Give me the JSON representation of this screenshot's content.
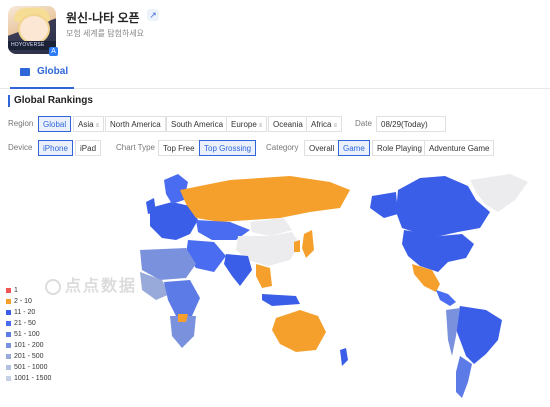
{
  "app": {
    "title": "원신-나타 오픈",
    "subtitle": "모험 세계를 탐험하세요",
    "icon_banner_text": "HOYOVERSE",
    "link_icon": "external-link-icon",
    "store_badge_icon": "app-store-icon"
  },
  "tabs": {
    "global_label": "Global",
    "global_icon": "chart-icon"
  },
  "section_title": "Global Rankings",
  "filters": {
    "region_label": "Region",
    "regions": [
      "Global",
      "Asia",
      "North America",
      "South America",
      "Europe",
      "Oceania",
      "Africa"
    ],
    "region_selected": "Global",
    "date_label": "Date",
    "date_value": "08/29(Today)",
    "device_label": "Device",
    "devices": [
      "iPhone",
      "iPad"
    ],
    "device_selected": "iPhone",
    "chart_type_label": "Chart Type",
    "chart_types": [
      "Top Free",
      "Top Grossing"
    ],
    "chart_type_selected": "Top Grossing",
    "category_label": "Category",
    "categories": [
      "Overall",
      "Game",
      "Role Playing",
      "Adventure Game"
    ],
    "category_selected": "Game"
  },
  "watermark": "点点数据",
  "legend": [
    {
      "label": "1",
      "color": "#f05454"
    },
    {
      "label": "2 - 10",
      "color": "#f5a02c"
    },
    {
      "label": "11 - 20",
      "color": "#3b5ee8"
    },
    {
      "label": "21 - 50",
      "color": "#4a6cf0"
    },
    {
      "label": "51 - 100",
      "color": "#5d7be6"
    },
    {
      "label": "101 - 200",
      "color": "#7a92de"
    },
    {
      "label": "201 - 500",
      "color": "#97aad9"
    },
    {
      "label": "501 - 1000",
      "color": "#b1c0de"
    },
    {
      "label": "1001 - 1500",
      "color": "#c7d1e6"
    }
  ],
  "colors": {
    "accent": "#2f66d8",
    "rank_top10": "#f5a02c",
    "rank_11_20": "#3b5ee8",
    "no_data": "#ececef"
  }
}
